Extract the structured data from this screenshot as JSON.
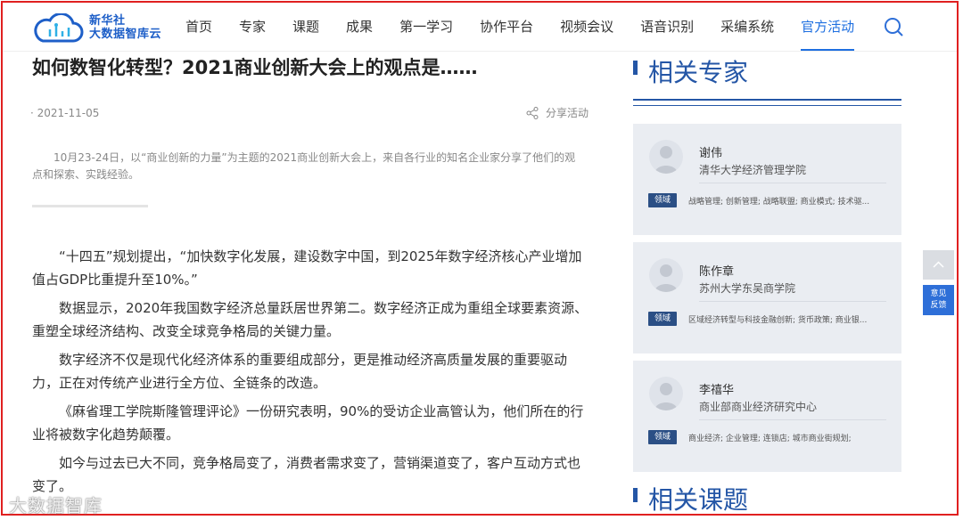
{
  "logo": {
    "line1": "新华社",
    "line2": "大数据智库云"
  },
  "nav": [
    "首页",
    "专家",
    "课题",
    "成果",
    "第一学习",
    "协作平台",
    "视频会议",
    "语音识别",
    "采编系统",
    "官方活动"
  ],
  "nav_active_index": 9,
  "article": {
    "title": "如何数智化转型？2021商业创新大会上的观点是……",
    "date": "· 2021-11-05",
    "share_label": "分享活动",
    "summary": "10月23-24日，以“商业创新的力量”为主题的2021商业创新大会上，来自各行业的知名企业家分享了他们的观点和探索、实践经验。",
    "paragraphs": [
      "“十四五”规划提出，“加快数字化发展，建设数字中国，到2025年数字经济核心产业增加值占GDP比重提升至10%。”",
      "数据显示，2020年我国数字经济总量跃居世界第二。数字经济正成为重组全球要素资源、重塑全球经济结构、改变全球竞争格局的关键力量。",
      "数字经济不仅是现代化经济体系的重要组成部分，更是推动经济高质量发展的重要驱动力，正在对传统产业进行全方位、全链条的改造。",
      "《麻省理工学院斯隆管理评论》一份研究表明，90%的受访企业高管认为，他们所在的行业将被数字化趋势颠覆。",
      "如今与过去已大不同，竞争格局变了，消费者需求变了，营销渠道变了，客户互动方式也变了。"
    ]
  },
  "sidebar": {
    "experts_heading": "相关专家",
    "topics_heading": "相关课题",
    "field_tag": "领域",
    "experts": [
      {
        "name": "谢伟",
        "org": "清华大学经济管理学院",
        "fields": "战略管理; 创新管理; 战略联盟; 商业模式; 技术驱..."
      },
      {
        "name": "陈作章",
        "org": "苏州大学东吴商学院",
        "fields": "区域经济转型与科技金融创新; 货币政策; 商业银..."
      },
      {
        "name": "李禧华",
        "org": "商业部商业经济研究中心",
        "fields": "商业经济; 企业管理; 连锁店; 城市商业街规划;"
      }
    ]
  },
  "feedback": {
    "line1": "意见",
    "line2": "反馈"
  },
  "watermark": "大数据智库",
  "colors": {
    "brand": "#2456a6",
    "nav_active": "#1e6fe0",
    "tag_bg": "#2b4f85",
    "card_bg": "#eaedf2",
    "feedback_bg": "#2e6fd8"
  }
}
